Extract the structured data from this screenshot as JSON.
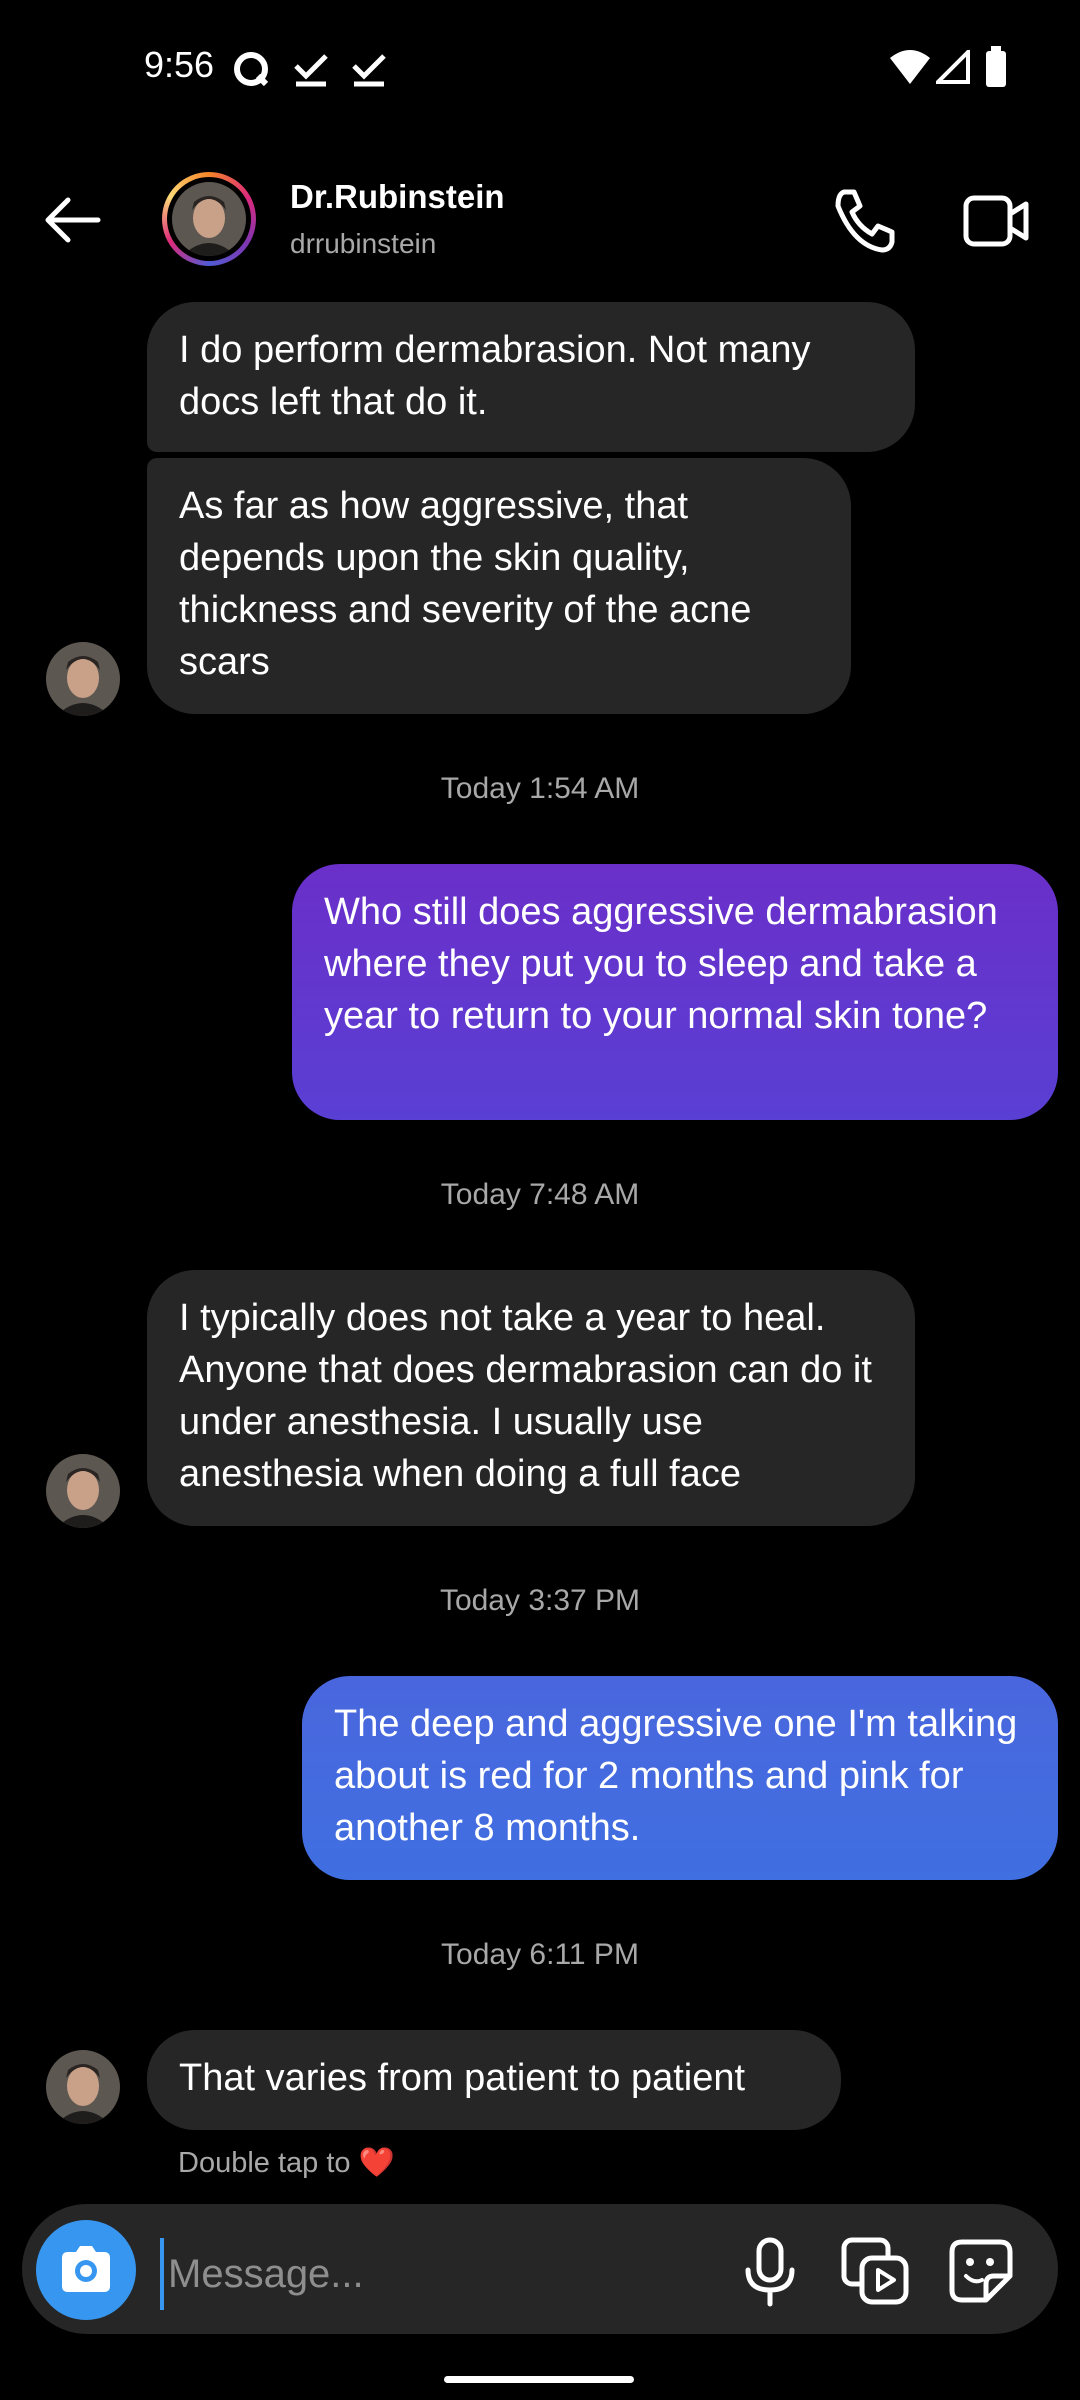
{
  "status_bar": {
    "time": "9:56"
  },
  "header": {
    "name": "Dr.Rubinstein",
    "username": "drrubinstein"
  },
  "messages": [
    {
      "type": "in",
      "text": "I do perform dermabrasion. Not many docs left that do it."
    },
    {
      "type": "in",
      "text": "As far as how aggressive, that depends upon the skin quality, thickness and severity of the acne scars"
    },
    {
      "type": "timestamp",
      "text": "Today 1:54 AM"
    },
    {
      "type": "out",
      "text": "Who still does aggressive dermabrasion where they put you to sleep and take a year to return to your normal skin tone?"
    },
    {
      "type": "timestamp",
      "text": "Today 7:48 AM"
    },
    {
      "type": "in",
      "text": "I typically does not take a year to heal. Anyone that does dermabrasion can do it under anesthesia. I usually use anesthesia when doing a full face"
    },
    {
      "type": "timestamp",
      "text": "Today 3:37 PM"
    },
    {
      "type": "out",
      "text": "The deep and aggressive one I'm talking about is red for 2 months and pink for another 8 months."
    },
    {
      "type": "timestamp",
      "text": "Today 6:11 PM"
    },
    {
      "type": "in",
      "text": "That varies from patient to patient"
    }
  ],
  "hint": {
    "text": "Double tap to",
    "emoji": "❤️"
  },
  "composer": {
    "placeholder": "Message..."
  },
  "colors": {
    "incoming": "#262626",
    "outgoing_top": "#6a2fc9",
    "outgoing_bottom": "#3f6fe0",
    "accent": "#3797f0"
  }
}
